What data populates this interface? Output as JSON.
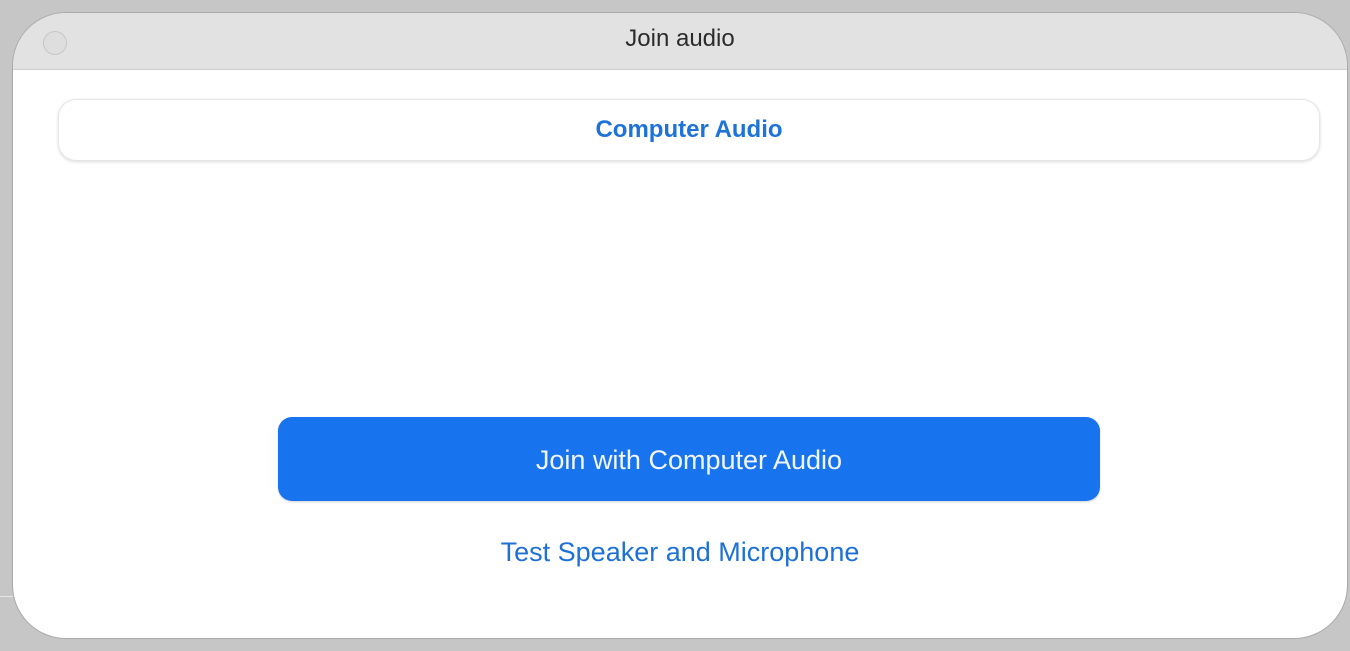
{
  "window": {
    "title": "Join audio"
  },
  "tabs": [
    {
      "label": "Computer Audio",
      "selected": true
    }
  ],
  "actions": {
    "join_label": "Join with Computer Audio",
    "test_label": "Test Speaker and Microphone"
  },
  "colors": {
    "accent": "#1774ee",
    "link": "#1d70d6",
    "titlebar": "#e2e2e2"
  }
}
